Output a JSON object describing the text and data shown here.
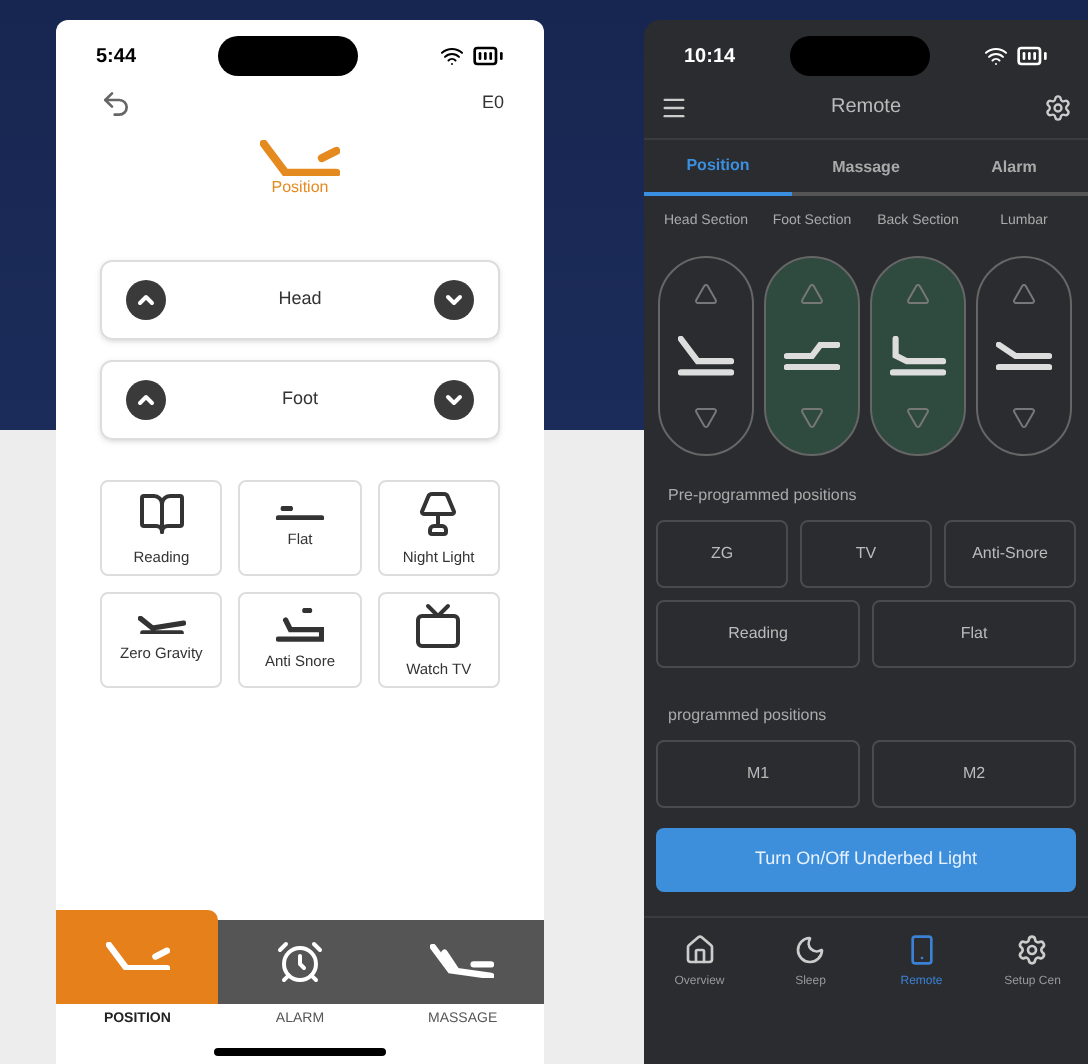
{
  "left_phone": {
    "status_time": "5:44",
    "code": "E0",
    "title": "Position",
    "adjusters": [
      {
        "label": "Head"
      },
      {
        "label": "Foot"
      }
    ],
    "presets": [
      {
        "label": "Reading",
        "kind": "book"
      },
      {
        "label": "Flat",
        "kind": "flat"
      },
      {
        "label": "Night Light",
        "kind": "light"
      },
      {
        "label": "Zero Gravity",
        "kind": "zerog"
      },
      {
        "label": "Anti Snore",
        "kind": "snore"
      },
      {
        "label": "Watch TV",
        "kind": "tv"
      }
    ],
    "nav": [
      {
        "label": "POSITION",
        "kind": "bed",
        "selected": true
      },
      {
        "label": "ALARM",
        "kind": "alarm",
        "selected": false
      },
      {
        "label": "MASSAGE",
        "kind": "massage",
        "selected": false
      }
    ]
  },
  "right_phone": {
    "status_time": "10:14",
    "title": "Remote",
    "tabs": [
      {
        "label": "Position",
        "selected": true
      },
      {
        "label": "Massage",
        "selected": false
      },
      {
        "label": "Alarm",
        "selected": false
      }
    ],
    "sections": [
      {
        "label": "Head Section",
        "selected": false
      },
      {
        "label": "Foot Section",
        "selected": true
      },
      {
        "label": "Back Section",
        "selected": true
      },
      {
        "label": "Lumbar",
        "selected": false
      }
    ],
    "preprogrammed_title": "Pre-programmed positions",
    "preprogrammed": [
      [
        "ZG",
        "TV",
        "Anti-Snore"
      ],
      [
        "Reading",
        "Flat"
      ]
    ],
    "programmed_title": "programmed positions",
    "programmed": [
      "M1",
      "M2"
    ],
    "light_button": "Turn On/Off Underbed Light",
    "nav": [
      {
        "label": "Overview",
        "kind": "home",
        "selected": false
      },
      {
        "label": "Sleep",
        "kind": "moon",
        "selected": false
      },
      {
        "label": "Remote",
        "kind": "remote",
        "selected": true
      },
      {
        "label": "Setup Cen",
        "kind": "setup",
        "selected": false
      }
    ]
  }
}
